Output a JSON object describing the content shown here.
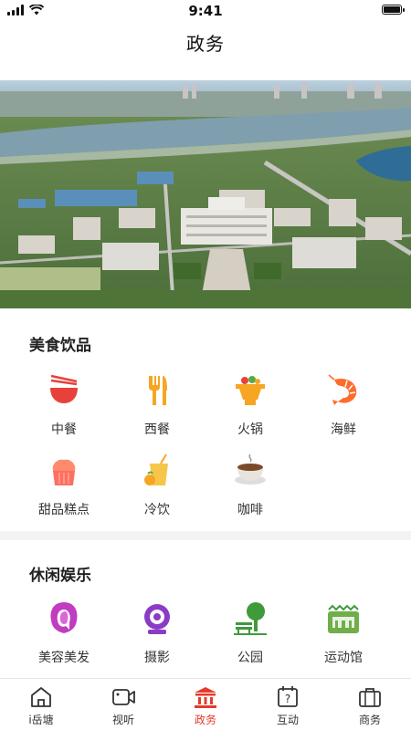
{
  "status_bar": {
    "time": "9:41"
  },
  "header": {
    "title": "政务"
  },
  "banner": {
    "image_description": "aerial city view"
  },
  "sections": [
    {
      "title": "美食饮品",
      "items": [
        {
          "label": "中餐",
          "icon": "bowl-chopsticks-icon"
        },
        {
          "label": "西餐",
          "icon": "fork-knife-icon"
        },
        {
          "label": "火锅",
          "icon": "hotpot-icon"
        },
        {
          "label": "海鲜",
          "icon": "shrimp-icon"
        },
        {
          "label": "甜品糕点",
          "icon": "cupcake-icon"
        },
        {
          "label": "冷饮",
          "icon": "cold-drink-icon"
        },
        {
          "label": "咖啡",
          "icon": "coffee-icon"
        }
      ]
    },
    {
      "title": "休闲娱乐",
      "items": [
        {
          "label": "美容美发",
          "icon": "beauty-hair-icon"
        },
        {
          "label": "摄影",
          "icon": "camera-icon"
        },
        {
          "label": "公园",
          "icon": "park-icon"
        },
        {
          "label": "运动馆",
          "icon": "stadium-icon"
        }
      ]
    }
  ],
  "tabbar": {
    "active": "政务",
    "active_color": "#e53b2c",
    "items": [
      {
        "label": "i岳塘",
        "icon": "home-icon"
      },
      {
        "label": "视听",
        "icon": "video-icon"
      },
      {
        "label": "政务",
        "icon": "government-icon"
      },
      {
        "label": "互动",
        "icon": "question-calendar-icon"
      },
      {
        "label": "商务",
        "icon": "briefcase-icon"
      }
    ]
  }
}
